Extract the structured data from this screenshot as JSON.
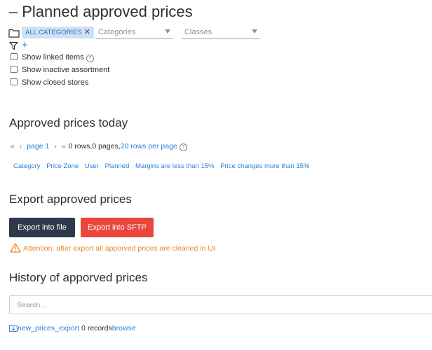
{
  "page": {
    "title": "Planned approved prices",
    "title_prefix": "–"
  },
  "filters": {
    "chip_label": "ALL CATEGORIES",
    "chip_close": "✕",
    "categories_placeholder": "Categories",
    "classes_placeholder": "Classes",
    "add": "+"
  },
  "checkboxes": [
    {
      "label": "Show linked items",
      "help": "?"
    },
    {
      "label": "Show inactive assortment"
    },
    {
      "label": "Show closed stores"
    }
  ],
  "approved_today": {
    "heading": "Approved prices today",
    "pager": {
      "first": "«",
      "prev": "‹",
      "page_label": "page 1",
      "next": "›",
      "last": "»",
      "summary": "0 rows,0 pages,",
      "rows_per_page": "20 rows per page",
      "help": "?"
    },
    "columns": [
      "Category",
      "Price Zone",
      "User",
      "Planned",
      "Margins are less than 15%",
      "Price changes more than 15%"
    ]
  },
  "export": {
    "heading": "Export approved prices",
    "export_file": "Export into file",
    "export_sftp": "Export into SFTP",
    "warning": "Attention: after export all apporved prices are cleaned in UI",
    "colors": {
      "dark_button": "#2e3a4b",
      "red_button": "#e9473b",
      "warning": "#e9862b",
      "link": "#2f7ed8"
    }
  },
  "history": {
    "heading": "History of apporved prices",
    "search_placeholder": "Search...",
    "item": {
      "name": "new_prices_export",
      "records": "0 records",
      "action": "browse",
      "icon": "folder-download-icon"
    }
  }
}
